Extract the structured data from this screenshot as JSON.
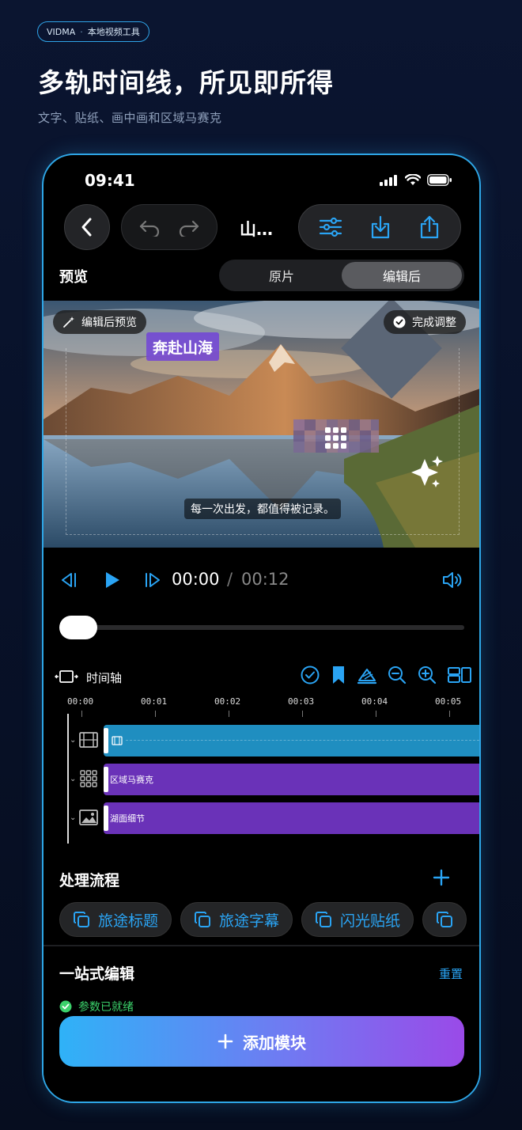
{
  "hero": {
    "badge_brand": "VIDMA",
    "badge_dot": "·",
    "badge_tag": "本地视频工具",
    "title": "多轨时间线，所见即所得",
    "subtitle": "文字、贴纸、画中画和区域马赛克"
  },
  "status_bar": {
    "time": "09:41"
  },
  "nav": {
    "title": "山…"
  },
  "preview_header": {
    "label": "预览",
    "segments": [
      "原片",
      "编辑后"
    ],
    "selected_segment": "编辑后"
  },
  "preview": {
    "mode_chip": "编辑后预览",
    "done_chip": "完成调整",
    "title_overlay": "奔赴山海",
    "caption": "每一次出发，都值得被记录。"
  },
  "transport": {
    "current": "00:00",
    "separator": "/",
    "total": "00:12",
    "progress": 0
  },
  "timeline": {
    "label": "时间轴",
    "ruler": [
      "00:00",
      "00:01",
      "00:02",
      "00:03",
      "00:04",
      "00:05"
    ],
    "tracks": [
      {
        "icon": "film-icon",
        "clip_name": "",
        "color": "#1f8ec0"
      },
      {
        "icon": "grid-icon",
        "clip_name": "区域马赛克",
        "color": "#6a32b8"
      },
      {
        "icon": "image-icon",
        "clip_name": "湖面细节",
        "color": "#6a32b8"
      }
    ]
  },
  "flow": {
    "title": "处理流程",
    "chips": [
      "旅途标题",
      "旅途字幕",
      "闪光贴纸"
    ]
  },
  "onestop": {
    "title": "一站式编辑",
    "reset": "重置",
    "status": "参数已就绪"
  },
  "add_button": {
    "label": "添加模块"
  },
  "colors": {
    "accent": "#2aa4f4",
    "ready": "#3bd16b",
    "frame": "#2ea6e6"
  }
}
